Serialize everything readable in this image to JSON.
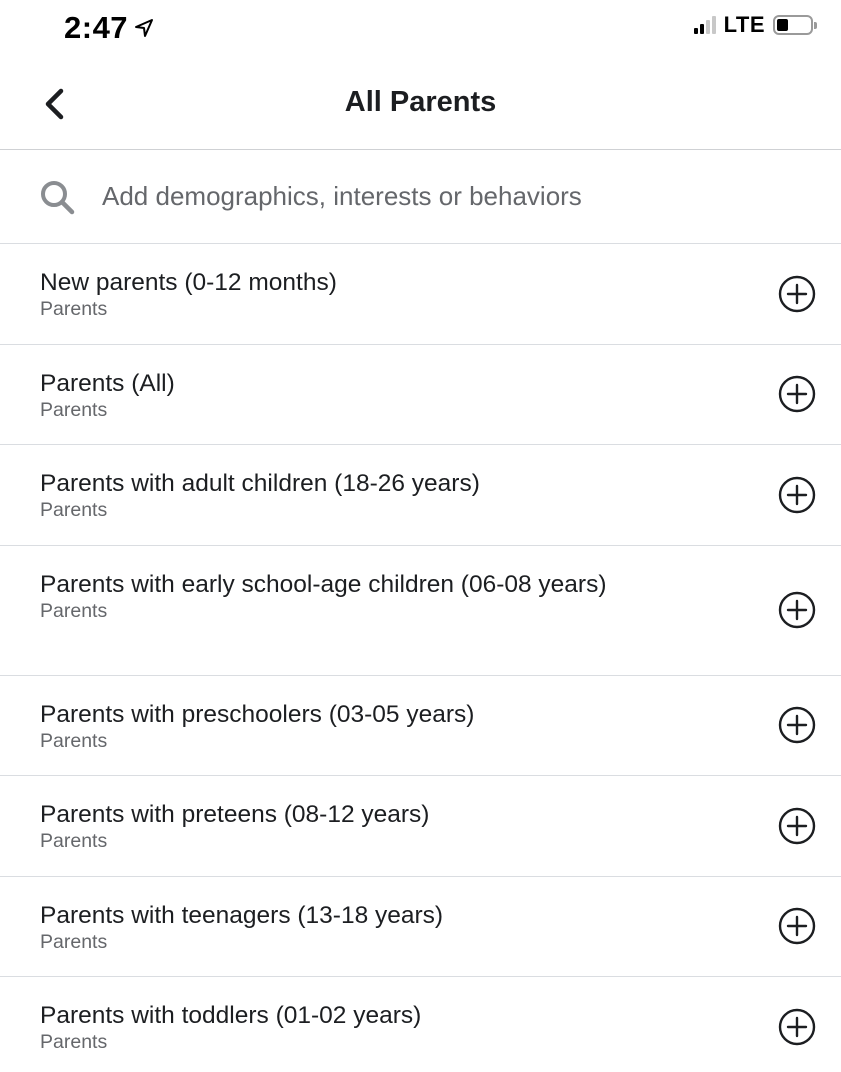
{
  "status_bar": {
    "time": "2:47",
    "network": "LTE",
    "signal_bars_filled": 2,
    "signal_bars_total": 4,
    "battery_level": 0.3
  },
  "header": {
    "title": "All Parents",
    "back_icon": "chevron-left-icon"
  },
  "search": {
    "placeholder": "Add demographics, interests or behaviors",
    "value": "",
    "icon": "search-icon"
  },
  "list": {
    "items": [
      {
        "title": "New parents (0-12 months)",
        "subtitle": "Parents"
      },
      {
        "title": "Parents (All)",
        "subtitle": "Parents"
      },
      {
        "title": "Parents with adult children (18-26 years)",
        "subtitle": "Parents"
      },
      {
        "title": "Parents with early school-age children (06-08 years)",
        "subtitle": "Parents"
      },
      {
        "title": "Parents with preschoolers (03-05 years)",
        "subtitle": "Parents"
      },
      {
        "title": "Parents with preteens (08-12 years)",
        "subtitle": "Parents"
      },
      {
        "title": "Parents with teenagers (13-18 years)",
        "subtitle": "Parents"
      },
      {
        "title": "Parents with toddlers (01-02 years)",
        "subtitle": "Parents"
      }
    ],
    "add_icon": "plus-circle-icon"
  },
  "colors": {
    "text_primary": "#1c1e21",
    "text_secondary": "#65676b",
    "divider": "#dadde1",
    "search_icon": "#8a8d91"
  }
}
